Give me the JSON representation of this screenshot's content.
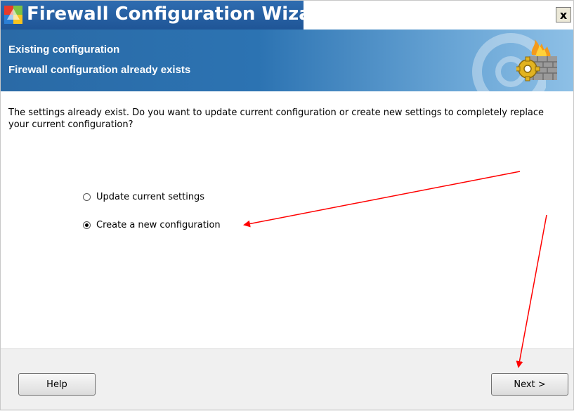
{
  "window": {
    "title": "Firewall Configuration Wizard",
    "close_label": "x"
  },
  "header": {
    "line1": "Existing configuration",
    "line2": "Firewall configuration already exists"
  },
  "body": {
    "message": "The settings already exist. Do you want to update current configuration or create new settings to completely replace your current configuration?"
  },
  "options": [
    {
      "label": "Update current settings",
      "selected": false
    },
    {
      "label": "Create a new configuration",
      "selected": true
    }
  ],
  "footer": {
    "help_label": "Help",
    "next_label": "Next >"
  },
  "colors": {
    "title_bar": "#2f6db1",
    "header_band": "#2c73b2",
    "annotation_arrow": "#ff0000"
  },
  "icons": {
    "title": "avg-logo-icon",
    "header": "firewall-gear-icon"
  }
}
